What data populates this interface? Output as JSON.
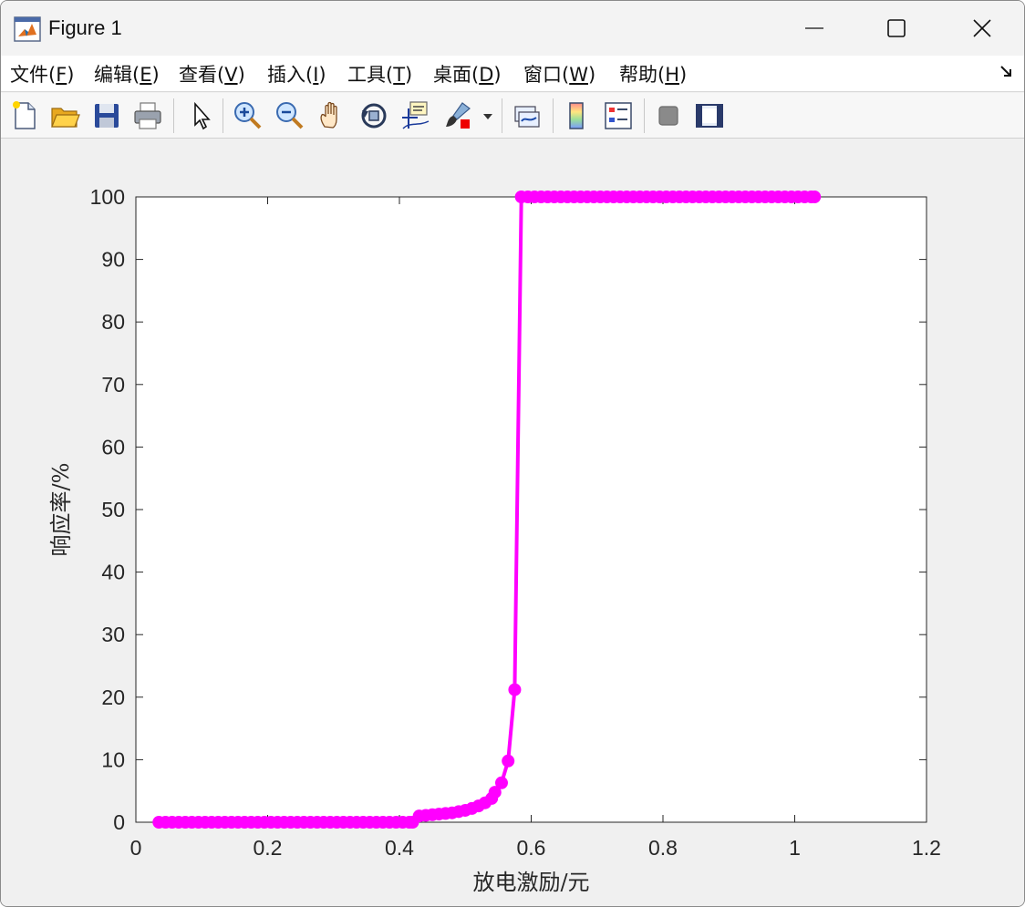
{
  "window": {
    "title": "Figure 1",
    "icon": "matlab-logo-icon"
  },
  "menu": [
    {
      "text": "文件(",
      "acc": "F",
      "tail": ")"
    },
    {
      "text": "编辑(",
      "acc": "E",
      "tail": ")"
    },
    {
      "text": "查看(",
      "acc": "V",
      "tail": ")"
    },
    {
      "text": "插入(",
      "acc": "I",
      "tail": ")"
    },
    {
      "text": "工具(",
      "acc": "T",
      "tail": ")"
    },
    {
      "text": "桌面(",
      "acc": "D",
      "tail": ")"
    },
    {
      "text": "窗口(",
      "acc": "W",
      "tail": ")"
    },
    {
      "text": "帮助(",
      "acc": "H",
      "tail": ")"
    }
  ],
  "toolbar": [
    "new-file-icon",
    "open-folder-icon",
    "save-icon",
    "print-icon",
    "select-arrow-icon",
    "zoom-in-icon",
    "zoom-out-icon",
    "pan-hand-icon",
    "rotate-3d-icon",
    "data-cursor-icon",
    "brush-icon",
    "link-plot-icon",
    "colorbar-icon",
    "legend-icon",
    "hide-plot-tools-icon",
    "show-plot-tools-icon"
  ],
  "colors": {
    "series": "#ff00ff",
    "axes": "#262626"
  },
  "chart_data": {
    "type": "line",
    "xlabel": "放电激励/元",
    "ylabel": "响应率/%",
    "xlim": [
      0,
      1.2
    ],
    "ylim": [
      0,
      100
    ],
    "xticks": [
      "0",
      "0.2",
      "0.4",
      "0.6",
      "0.8",
      "1",
      "1.2"
    ],
    "yticks": [
      "0",
      "10",
      "20",
      "30",
      "40",
      "50",
      "60",
      "70",
      "80",
      "90",
      "100"
    ],
    "grid": false,
    "markers": "filled-circle",
    "series": [
      {
        "x": [
          0.035,
          0.045,
          0.055,
          0.065,
          0.075,
          0.085,
          0.095,
          0.105,
          0.115,
          0.125,
          0.135,
          0.145,
          0.155,
          0.165,
          0.175,
          0.185,
          0.195,
          0.205,
          0.215,
          0.225,
          0.235,
          0.245,
          0.255,
          0.265,
          0.275,
          0.285,
          0.295,
          0.305,
          0.315,
          0.325,
          0.335,
          0.345,
          0.355,
          0.365,
          0.375,
          0.385,
          0.395,
          0.405,
          0.415,
          0.42,
          0.43,
          0.44,
          0.45,
          0.46,
          0.47,
          0.48,
          0.49,
          0.5,
          0.51,
          0.52,
          0.53,
          0.54,
          0.545,
          0.555,
          0.565,
          0.575,
          0.585,
          0.595,
          0.605,
          0.615,
          0.625,
          0.635,
          0.645,
          0.655,
          0.665,
          0.675,
          0.685,
          0.695,
          0.705,
          0.715,
          0.725,
          0.735,
          0.745,
          0.755,
          0.765,
          0.775,
          0.785,
          0.795,
          0.805,
          0.815,
          0.825,
          0.835,
          0.845,
          0.855,
          0.865,
          0.875,
          0.885,
          0.895,
          0.905,
          0.915,
          0.925,
          0.935,
          0.945,
          0.955,
          0.965,
          0.975,
          0.985,
          0.995,
          1.005,
          1.015,
          1.025,
          1.03
        ],
        "y": [
          0,
          0,
          0,
          0,
          0,
          0,
          0,
          0,
          0,
          0,
          0,
          0,
          0,
          0,
          0,
          0,
          0,
          0,
          0,
          0,
          0,
          0,
          0,
          0,
          0,
          0,
          0,
          0,
          0,
          0,
          0,
          0,
          0,
          0,
          0,
          0,
          0,
          0,
          0,
          0,
          1.0,
          1.1,
          1.2,
          1.3,
          1.4,
          1.5,
          1.7,
          1.9,
          2.2,
          2.6,
          3.1,
          3.8,
          4.8,
          6.3,
          9.8,
          21.2,
          100,
          100,
          100,
          100,
          100,
          100,
          100,
          100,
          100,
          100,
          100,
          100,
          100,
          100,
          100,
          100,
          100,
          100,
          100,
          100,
          100,
          100,
          100,
          100,
          100,
          100,
          100,
          100,
          100,
          100,
          100,
          100,
          100,
          100,
          100,
          100,
          100,
          100,
          100,
          100,
          100,
          100,
          100,
          100,
          100,
          100
        ]
      }
    ]
  }
}
